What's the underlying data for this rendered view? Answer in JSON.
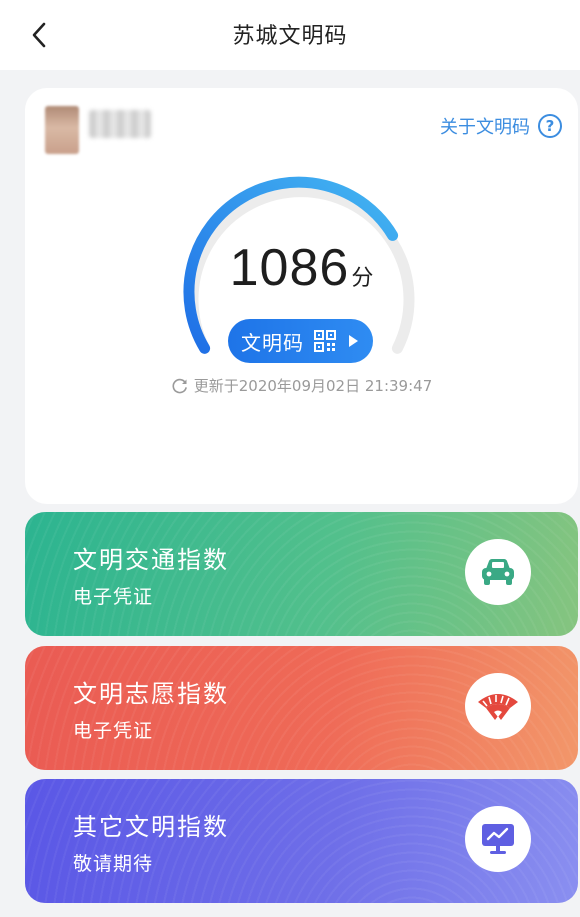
{
  "header": {
    "title": "苏城文明码",
    "back_icon": "chevron-left-icon"
  },
  "score_card": {
    "about_link": "关于文明码",
    "help_icon": "question-circle-icon",
    "score": "1086",
    "score_unit": "分",
    "code_button_label": "文明码",
    "code_button_icons": [
      "qr-code-icon",
      "play-right-icon"
    ],
    "updated_text": "更新于2020年09月02日 21:39:47",
    "refresh_icon": "refresh-icon",
    "gauge_colors": {
      "start": "#1f6fe6",
      "end": "#44b6f2",
      "track": "#ececec"
    }
  },
  "index_cards": [
    {
      "title": "文明交通指数",
      "subtitle": "电子凭证",
      "icon": "car-icon",
      "color": "#2cb490"
    },
    {
      "title": "文明志愿指数",
      "subtitle": "电子凭证",
      "icon": "volunteer-fan-icon",
      "color": "#ea5b53"
    },
    {
      "title": "其它文明指数",
      "subtitle": "敬请期待",
      "icon": "monitor-chart-icon",
      "color": "#5a57e6"
    }
  ]
}
